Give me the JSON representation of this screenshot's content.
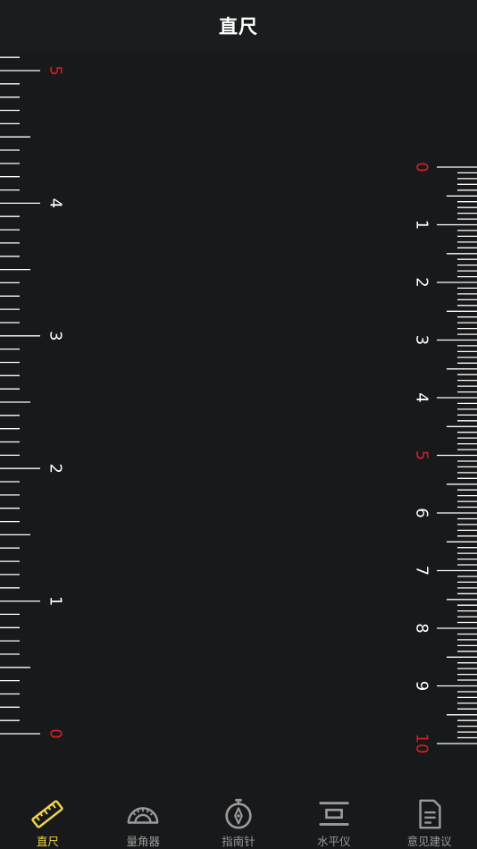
{
  "header": {
    "title": "直尺"
  },
  "colors": {
    "background": "#18191b",
    "tick": "#ffffff",
    "accent_red": "#d81e28",
    "active_tab": "#f0d34a",
    "inactive_tab": "#9a9a9a"
  },
  "rulers": {
    "left": {
      "unit": "inch",
      "labels": [
        "0",
        "1",
        "2",
        "3",
        "4",
        "5"
      ],
      "red_labels": [
        "0",
        "5"
      ]
    },
    "right": {
      "unit": "cm",
      "labels": [
        "0",
        "1",
        "2",
        "3",
        "4",
        "5",
        "6",
        "7",
        "8",
        "9",
        "10"
      ],
      "red_labels": [
        "0",
        "5",
        "10"
      ]
    }
  },
  "tabs": [
    {
      "label": "直尺",
      "icon": "ruler-icon",
      "active": true
    },
    {
      "label": "量角器",
      "icon": "protractor-icon",
      "active": false
    },
    {
      "label": "指南针",
      "icon": "compass-icon",
      "active": false
    },
    {
      "label": "水平仪",
      "icon": "level-icon",
      "active": false
    },
    {
      "label": "意见建议",
      "icon": "feedback-icon",
      "active": false
    }
  ]
}
